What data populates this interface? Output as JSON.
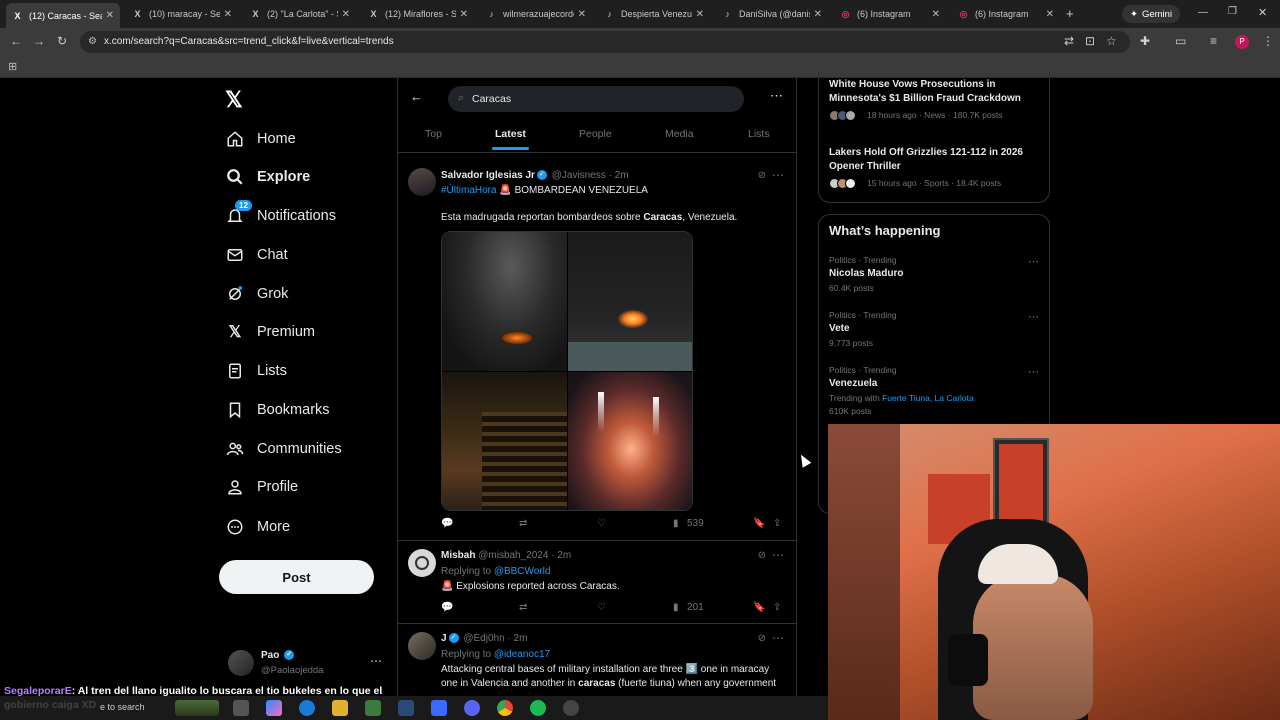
{
  "browser": {
    "tabs": [
      {
        "label": "(12) Caracas - Search",
        "favicon": "X"
      },
      {
        "label": "(10) maracay - Search",
        "favicon": "X"
      },
      {
        "label": "(2) \"La Carlota\" - Search",
        "favicon": "X"
      },
      {
        "label": "(12) Miraflores - Search",
        "favicon": "X"
      },
      {
        "label": "wilmerazuajecordero",
        "favicon": "♪"
      },
      {
        "label": "Despierta Venezuela",
        "favicon": "♪"
      },
      {
        "label": "DaniSilva (@danisilva",
        "favicon": "♪"
      },
      {
        "label": "(6) Instagram",
        "favicon": "◎"
      },
      {
        "label": "(6) Instagram",
        "favicon": "◎"
      }
    ],
    "new_tab": "+",
    "gemini_label": "Gemini",
    "url": "x.com/search?q=Caracas&src=trend_click&f=live&vertical=trends",
    "profile_initial": "P"
  },
  "nav": {
    "items": [
      {
        "label": "Home",
        "icon": "home-icon"
      },
      {
        "label": "Explore",
        "icon": "search-icon"
      },
      {
        "label": "Notifications",
        "icon": "bell-icon"
      },
      {
        "label": "Chat",
        "icon": "mail-icon"
      },
      {
        "label": "Grok",
        "icon": "grok-icon"
      },
      {
        "label": "Premium",
        "icon": "x-icon"
      },
      {
        "label": "Lists",
        "icon": "list-icon"
      },
      {
        "label": "Bookmarks",
        "icon": "bookmark-icon"
      },
      {
        "label": "Communities",
        "icon": "people-icon"
      },
      {
        "label": "Profile",
        "icon": "person-icon"
      },
      {
        "label": "More",
        "icon": "more-circle-icon"
      }
    ],
    "notifications_badge": "12",
    "post_label": "Post",
    "account": {
      "name": "Pao",
      "handle": "@Paolaojedda"
    }
  },
  "search": {
    "value": "Caracas",
    "tabs": [
      "Top",
      "Latest",
      "People",
      "Media",
      "Lists"
    ],
    "active_tab": "Latest"
  },
  "posts": [
    {
      "name": "Salvador Iglesias Jr",
      "handle": "@Javisness",
      "time": "· 2m",
      "line1_hashtag": "#ÚltimaHora",
      "line1_rest": "🚨 BOMBARDEAN VENEZUELA",
      "body_pre": "Esta madrugada reportan bombardeos sobre ",
      "body_bold": "Caracas",
      "body_post": ", Venezuela.",
      "views": "539"
    },
    {
      "name": "Misbah",
      "handle": "@misbah_2024",
      "time": "· 2m",
      "replying_label": "Replying to ",
      "replying_to": "@BBCWorld",
      "body": "🚨 Explosions reported across Caracas.",
      "views": "201"
    },
    {
      "name": "J",
      "handle": "@Edj0hn",
      "time": "· 2m",
      "replying_label": "Replying to ",
      "replying_to": "@ideanoc17",
      "body_line1": "Attacking central bases of military installation are three 3️⃣ one in maracay",
      "body_line2_pre": "one in Valencia and another in ",
      "body_line2_bold": "caracas",
      "body_line2_post": " (fuerte tiuna) when any government"
    }
  ],
  "right": {
    "news": [
      {
        "title_line1": "White House Vows Prosecutions in",
        "title_line2": "Minnesota's $1 Billion Fraud Crackdown",
        "meta": "18 hours ago · News · 180.7K posts"
      },
      {
        "title_line1": "Lakers Hold Off Grizzlies 121-112 in 2026",
        "title_line2": "Opener Thriller",
        "meta": "15 hours ago · Sports · 18.4K posts"
      }
    ],
    "happening_title": "What’s happening",
    "trends": [
      {
        "category": "Politics · Trending",
        "name": "Nicolas Maduro",
        "posts": "60.4K posts"
      },
      {
        "category": "Politics · Trending",
        "name": "Vete",
        "posts": "9,773 posts"
      },
      {
        "category": "Politics · Trending",
        "name": "Venezuela",
        "trending_with_label": "Trending with ",
        "trending_with": "Fuerte Tiuna, La Carlota",
        "posts": "610K posts"
      }
    ]
  },
  "chat_overlay": {
    "user": "SegaleporarE",
    "message": ": Al tren del llano igualito lo buscara el tio bukeles en lo que el gobierno caiga XD"
  },
  "taskbar": {
    "search_placeholder": "e to search"
  },
  "colors": {
    "accent": "#1d9bf0",
    "background": "#000000",
    "text": "#e7e9ea",
    "muted": "#71767b"
  }
}
